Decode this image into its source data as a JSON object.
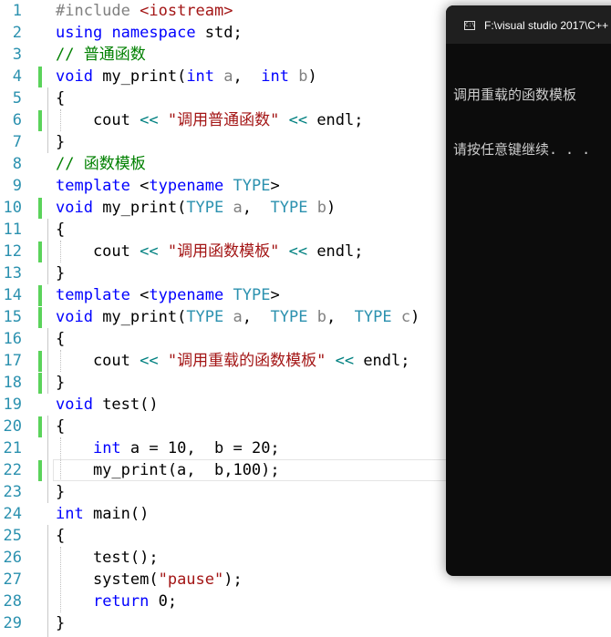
{
  "editor": {
    "lines": [
      {
        "num": "1",
        "parts": [
          [
            "#include ",
            "pp"
          ],
          [
            "<iostream>",
            "inc"
          ]
        ]
      },
      {
        "num": "2",
        "parts": [
          [
            "using",
            "kw"
          ],
          [
            " ",
            ""
          ],
          [
            "namespace",
            "kw"
          ],
          [
            " std;",
            ""
          ]
        ]
      },
      {
        "num": "3",
        "parts": [
          [
            "// 普通函数",
            "cm"
          ]
        ]
      },
      {
        "num": "4",
        "parts": [
          [
            "void",
            "kw"
          ],
          [
            " my_print(",
            ""
          ],
          [
            "int",
            "kw"
          ],
          [
            " ",
            ""
          ],
          [
            "a",
            "param"
          ],
          [
            ",  ",
            ""
          ],
          [
            "int",
            "kw"
          ],
          [
            " ",
            ""
          ],
          [
            "b",
            "param"
          ],
          [
            ")",
            ""
          ]
        ]
      },
      {
        "num": "5",
        "parts": [
          [
            "{",
            ""
          ]
        ]
      },
      {
        "num": "6",
        "parts": [
          [
            "    cout ",
            ""
          ],
          [
            "<<",
            "op"
          ],
          [
            " ",
            ""
          ],
          [
            "\"调用普通函数\"",
            "str"
          ],
          [
            " ",
            ""
          ],
          [
            "<<",
            "op"
          ],
          [
            " endl;",
            ""
          ]
        ]
      },
      {
        "num": "7",
        "parts": [
          [
            "}",
            ""
          ]
        ]
      },
      {
        "num": "8",
        "parts": [
          [
            "// 函数模板",
            "cm"
          ]
        ]
      },
      {
        "num": "9",
        "parts": [
          [
            "template",
            "kw"
          ],
          [
            " <",
            ""
          ],
          [
            "typename",
            "kw"
          ],
          [
            " ",
            ""
          ],
          [
            "TYPE",
            "type"
          ],
          [
            ">",
            ""
          ]
        ]
      },
      {
        "num": "10",
        "parts": [
          [
            "void",
            "kw"
          ],
          [
            " my_print(",
            ""
          ],
          [
            "TYPE",
            "type"
          ],
          [
            " ",
            ""
          ],
          [
            "a",
            "param"
          ],
          [
            ",  ",
            ""
          ],
          [
            "TYPE",
            "type"
          ],
          [
            " ",
            ""
          ],
          [
            "b",
            "param"
          ],
          [
            ")",
            ""
          ]
        ]
      },
      {
        "num": "11",
        "parts": [
          [
            "{",
            ""
          ]
        ]
      },
      {
        "num": "12",
        "parts": [
          [
            "    cout ",
            ""
          ],
          [
            "<<",
            "op"
          ],
          [
            " ",
            ""
          ],
          [
            "\"调用函数模板\"",
            "str"
          ],
          [
            " ",
            ""
          ],
          [
            "<<",
            "op"
          ],
          [
            " endl;",
            ""
          ]
        ]
      },
      {
        "num": "13",
        "parts": [
          [
            "}",
            ""
          ]
        ]
      },
      {
        "num": "14",
        "parts": [
          [
            "template",
            "kw"
          ],
          [
            " <",
            ""
          ],
          [
            "typename",
            "kw"
          ],
          [
            " ",
            ""
          ],
          [
            "TYPE",
            "type"
          ],
          [
            ">",
            ""
          ]
        ]
      },
      {
        "num": "15",
        "parts": [
          [
            "void",
            "kw"
          ],
          [
            " my_print(",
            ""
          ],
          [
            "TYPE",
            "type"
          ],
          [
            " ",
            ""
          ],
          [
            "a",
            "param"
          ],
          [
            ",  ",
            ""
          ],
          [
            "TYPE",
            "type"
          ],
          [
            " ",
            ""
          ],
          [
            "b",
            "param"
          ],
          [
            ",  ",
            ""
          ],
          [
            "TYPE",
            "type"
          ],
          [
            " ",
            ""
          ],
          [
            "c",
            "param"
          ],
          [
            ")",
            ""
          ]
        ]
      },
      {
        "num": "16",
        "parts": [
          [
            "{",
            ""
          ]
        ]
      },
      {
        "num": "17",
        "parts": [
          [
            "    cout ",
            ""
          ],
          [
            "<<",
            "op"
          ],
          [
            " ",
            ""
          ],
          [
            "\"调用重载的函数模板\"",
            "str"
          ],
          [
            " ",
            ""
          ],
          [
            "<<",
            "op"
          ],
          [
            " endl;",
            ""
          ]
        ]
      },
      {
        "num": "18",
        "parts": [
          [
            "}",
            ""
          ]
        ]
      },
      {
        "num": "19",
        "parts": [
          [
            "void",
            "kw"
          ],
          [
            " test()",
            ""
          ]
        ]
      },
      {
        "num": "20",
        "parts": [
          [
            "{",
            ""
          ]
        ]
      },
      {
        "num": "21",
        "parts": [
          [
            "    ",
            ""
          ],
          [
            "int",
            "kw"
          ],
          [
            " a = 10,  b = 20;",
            ""
          ]
        ]
      },
      {
        "num": "22",
        "parts": [
          [
            "    my_print(a,  b,100);",
            ""
          ]
        ]
      },
      {
        "num": "23",
        "parts": [
          [
            "}",
            ""
          ]
        ]
      },
      {
        "num": "24",
        "parts": [
          [
            "int",
            "kw"
          ],
          [
            " main()",
            ""
          ]
        ]
      },
      {
        "num": "25",
        "parts": [
          [
            "{",
            ""
          ]
        ]
      },
      {
        "num": "26",
        "parts": [
          [
            "    test();",
            ""
          ]
        ]
      },
      {
        "num": "27",
        "parts": [
          [
            "    system(",
            ""
          ],
          [
            "\"pause\"",
            "str"
          ],
          [
            ");",
            ""
          ]
        ]
      },
      {
        "num": "28",
        "parts": [
          [
            "    ",
            ""
          ],
          [
            "return",
            "kw"
          ],
          [
            " 0;",
            ""
          ]
        ]
      },
      {
        "num": "29",
        "parts": [
          [
            "}",
            ""
          ]
        ]
      }
    ],
    "changed_lines": [
      "4",
      "6",
      "10",
      "12",
      "14",
      "15",
      "17",
      "18",
      "20",
      "22"
    ]
  },
  "console": {
    "icon_label": "C:\\",
    "title": "F:\\visual studio 2017\\C++",
    "output_line_1": "调用重载的函数模板",
    "output_line_2": "请按任意键继续. . ."
  }
}
